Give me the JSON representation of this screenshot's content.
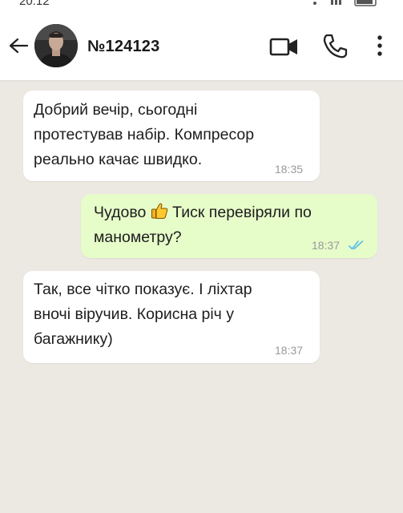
{
  "status_bar": {
    "time": "20:12"
  },
  "header": {
    "back_icon": "arrow-left-icon",
    "contact_name": "№124123",
    "video_icon": "video-camera-icon",
    "call_icon": "phone-icon",
    "menu_icon": "more-vertical-icon"
  },
  "messages": [
    {
      "direction": "incoming",
      "text": "Добрий вечір, сьогодні\nпротестував набір. Компресор\nреально качає швидко.",
      "time": "18:35"
    },
    {
      "direction": "outgoing",
      "text_before_emoji": "Чудово",
      "emoji": "thumbs-up-icon",
      "text_after_emoji": "Тиск перевіряли по\nманометру?",
      "time": "18:37",
      "status_icon": "double-check-icon"
    },
    {
      "direction": "incoming",
      "text": "Так, все чітко показує. І ліхтар\nвночі віручив. Корисна річ у\nбагажнику)",
      "time": "18:37"
    }
  ],
  "colors": {
    "chat_background": "#ece8e2",
    "incoming_bubble": "#ffffff",
    "outgoing_bubble": "#e6fcc9",
    "read_ticks": "#53bdeb"
  }
}
